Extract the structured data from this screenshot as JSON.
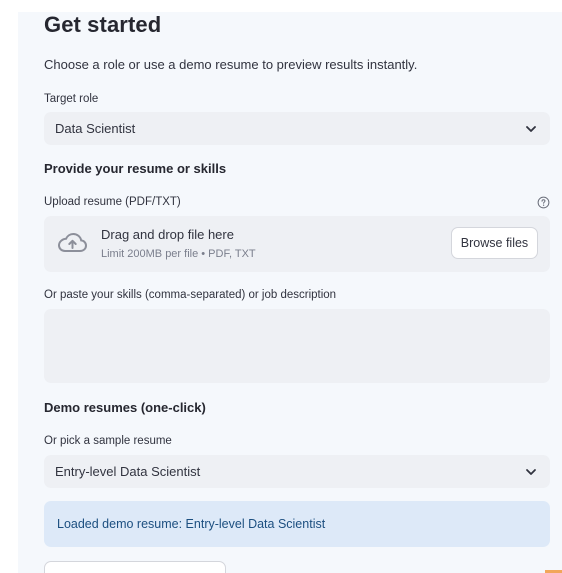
{
  "header": {
    "title": "Get started",
    "intro": "Choose a role or use a demo resume to preview results instantly."
  },
  "target_role": {
    "label": "Target role",
    "selected": "Data Scientist",
    "icon": "chevron-down-icon"
  },
  "resume_section": {
    "heading": "Provide your resume or skills",
    "upload_label": "Upload resume (PDF/TXT)",
    "help_icon": "question-circle-icon",
    "dropzone_title": "Drag and drop file here",
    "dropzone_subtitle": "Limit 200MB per file • PDF, TXT",
    "browse_label": "Browse files",
    "upload_icon": "cloud-upload-icon",
    "paste_label": "Or paste your skills (comma-separated) or job description",
    "paste_value": ""
  },
  "demo_section": {
    "heading": "Demo resumes (one-click)",
    "sample_label": "Or pick a sample resume",
    "selected": "Entry-level Data Scientist",
    "info_message": "Loaded demo resume: Entry-level Data Scientist"
  },
  "colors": {
    "panel_bg": "#f5f8fc",
    "input_bg": "#eef0f4",
    "info_bg": "#dde9f8",
    "info_text": "#1c4f80",
    "text": "#31333f"
  }
}
